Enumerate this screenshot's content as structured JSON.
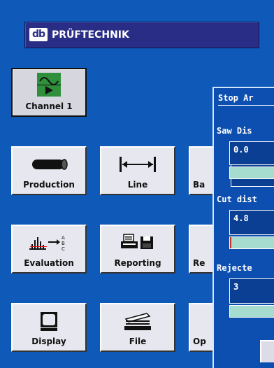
{
  "header": {
    "logo_text": "db",
    "brand": "PRÜFTECHNIK"
  },
  "tiles": {
    "channel": {
      "label": "Channel 1"
    },
    "production": {
      "label": "Production"
    },
    "line": {
      "label": "Line"
    },
    "ba": {
      "label": "Ba"
    },
    "evaluation": {
      "label": "Evaluation"
    },
    "reporting": {
      "label": "Reporting"
    },
    "re": {
      "label": "Re"
    },
    "display": {
      "label": "Display"
    },
    "file": {
      "label": "File"
    },
    "op": {
      "label": "Op"
    }
  },
  "panel": {
    "title": "Stop Ar",
    "fields": [
      {
        "label": "Saw Dis",
        "value": "0.0",
        "fill": 0
      },
      {
        "label": "Cut dist",
        "value": "4.8",
        "fill": 0.03
      },
      {
        "label": "Rejecte",
        "value": "3",
        "fill": 0
      }
    ]
  },
  "colors": {
    "background": "#0f59b8",
    "header": "#2a2d86",
    "tile": "#e7e7ef",
    "bar": "#a6dbd0",
    "bar_fill": "#c8321e"
  }
}
